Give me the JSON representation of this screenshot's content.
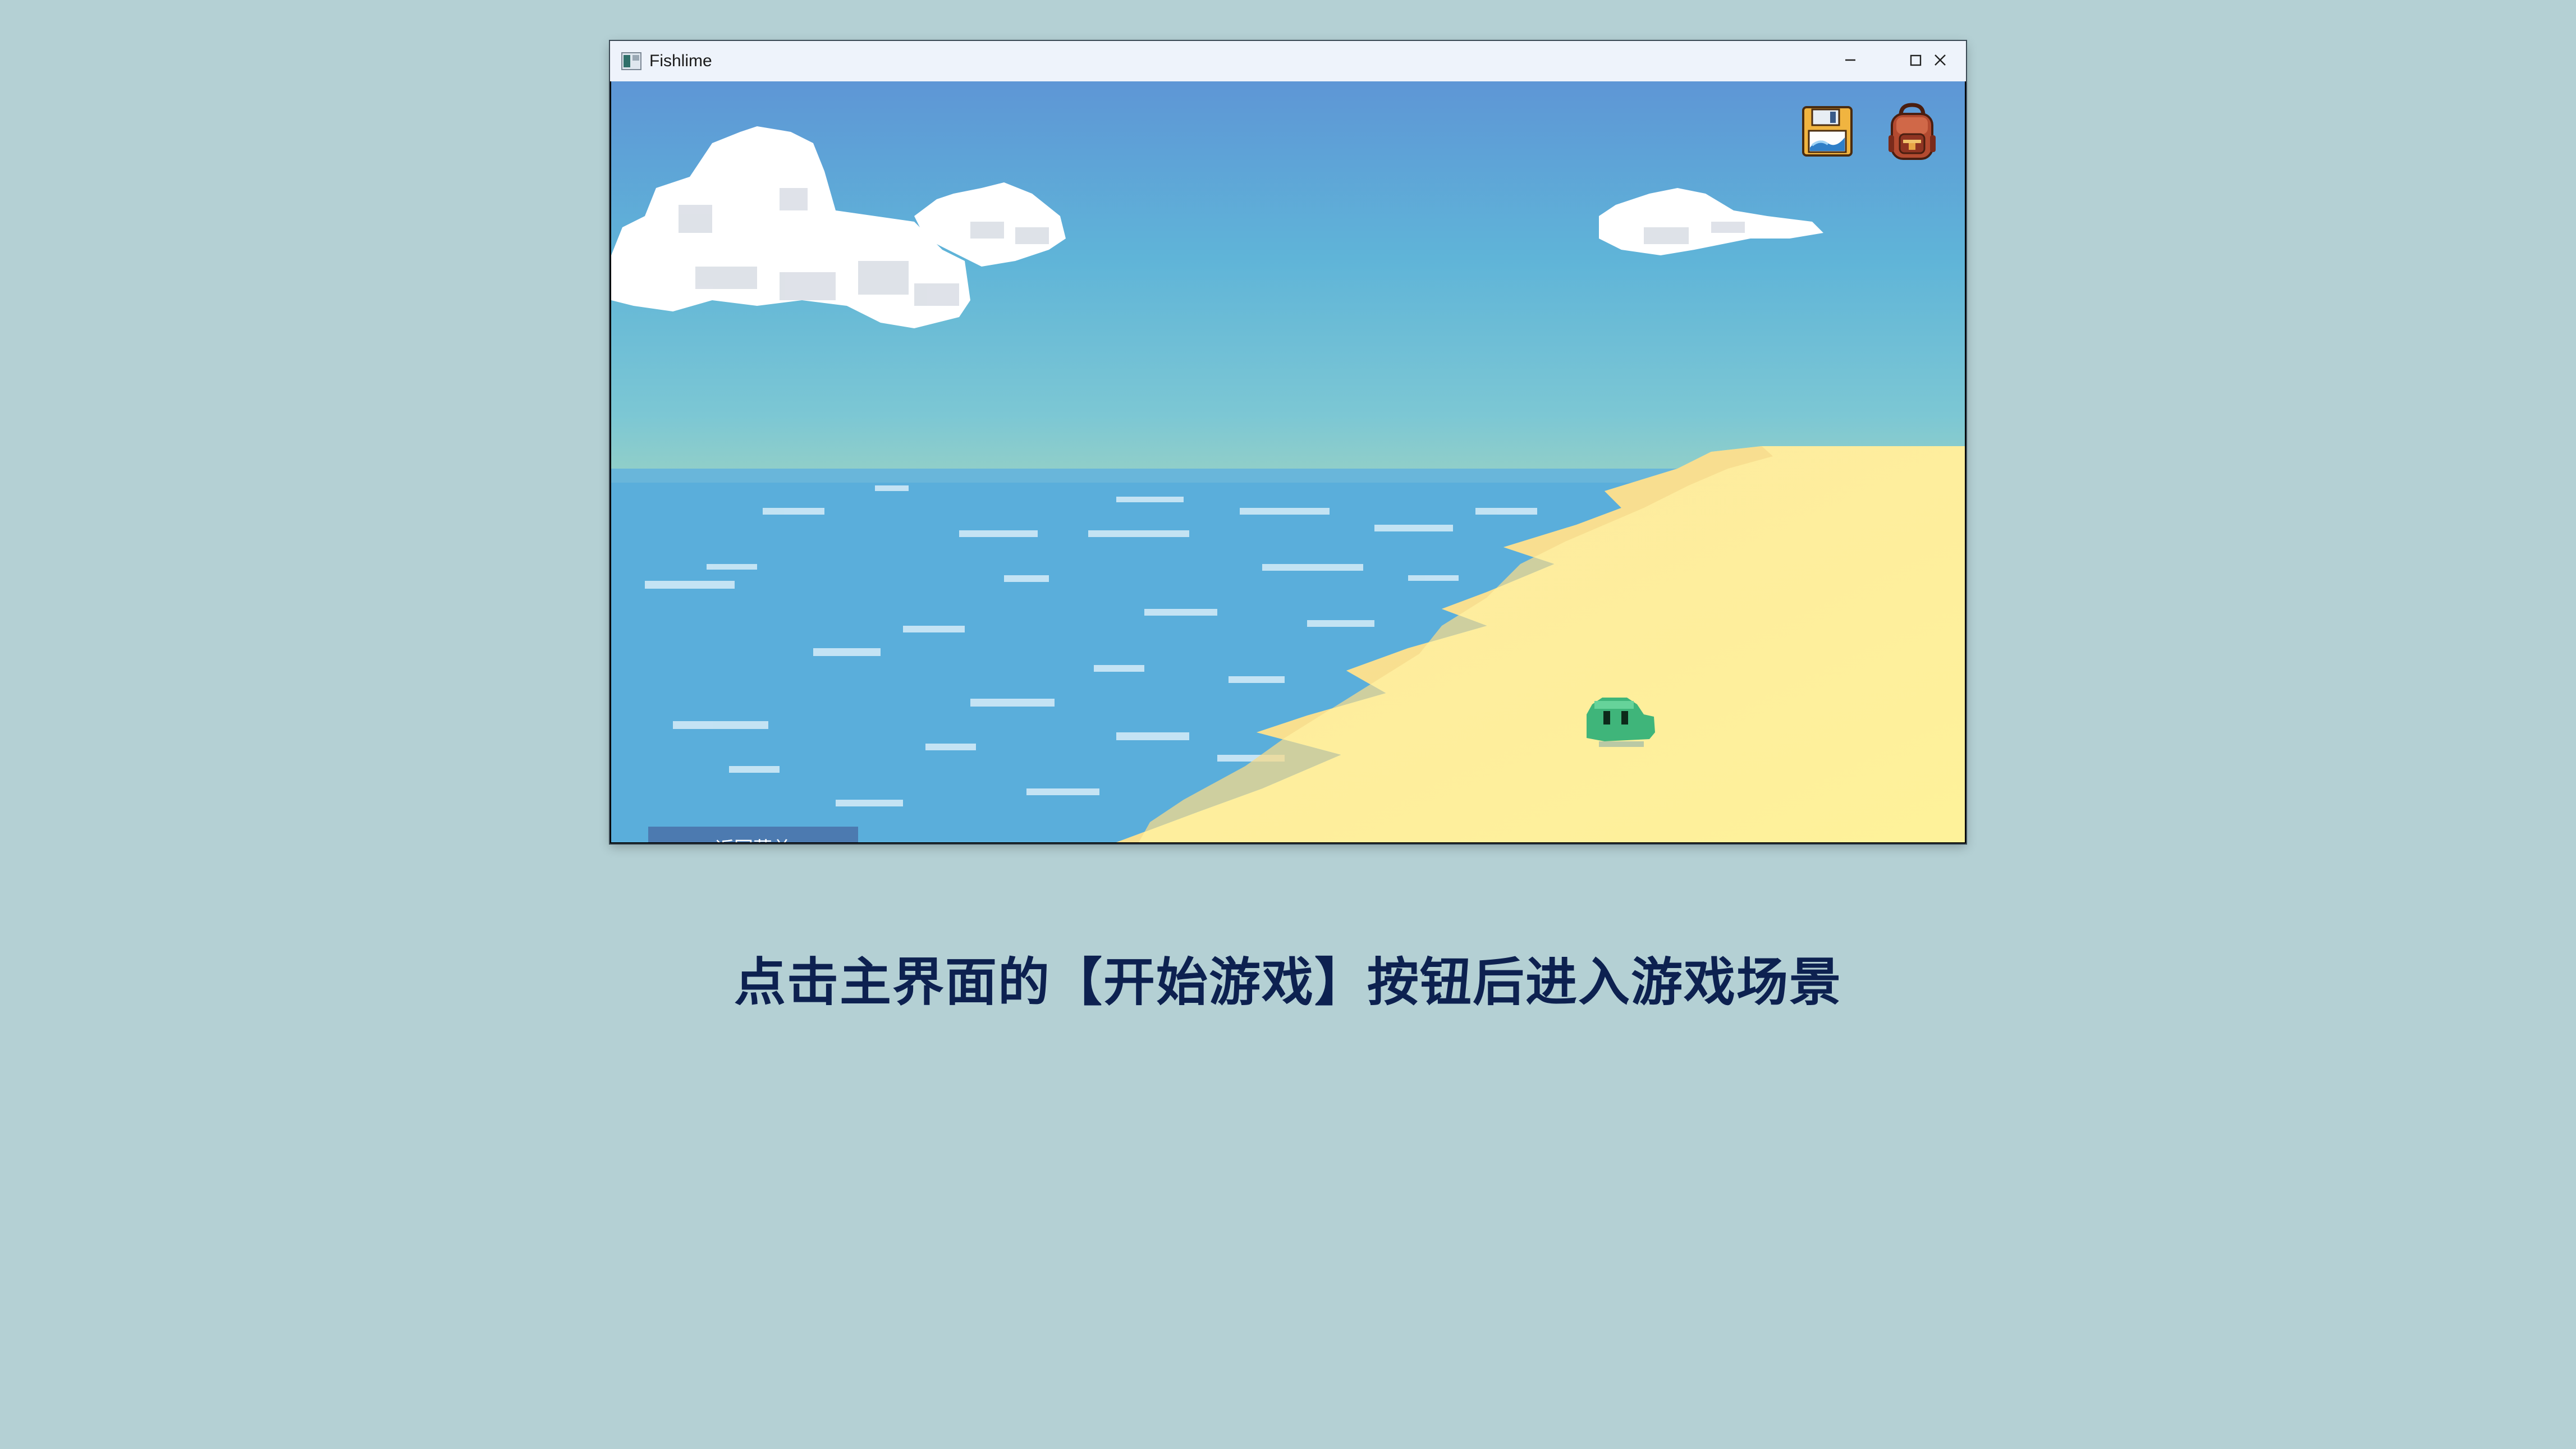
{
  "window": {
    "title": "Fishlime",
    "icons": {
      "app": "app-window-icon",
      "minimize": "minimize-icon",
      "maximize": "maximize-icon",
      "close": "close-icon"
    }
  },
  "game": {
    "back_button_label": "返回菜单",
    "toolbar": {
      "save_icon": "save-floppy-icon",
      "bag_icon": "backpack-icon"
    },
    "character": "slime-character"
  },
  "caption": "点击主界面的【开始游戏】按钮后进入游戏场景",
  "colors": {
    "page_background": "#b4d0d4",
    "sky_top": "#5e96d6",
    "sky_bottom": "#8ccbd0",
    "sea": "#5aaedb",
    "sand": "#fdf09c",
    "button": "#4c7ab0",
    "caption": "#0d2150"
  }
}
